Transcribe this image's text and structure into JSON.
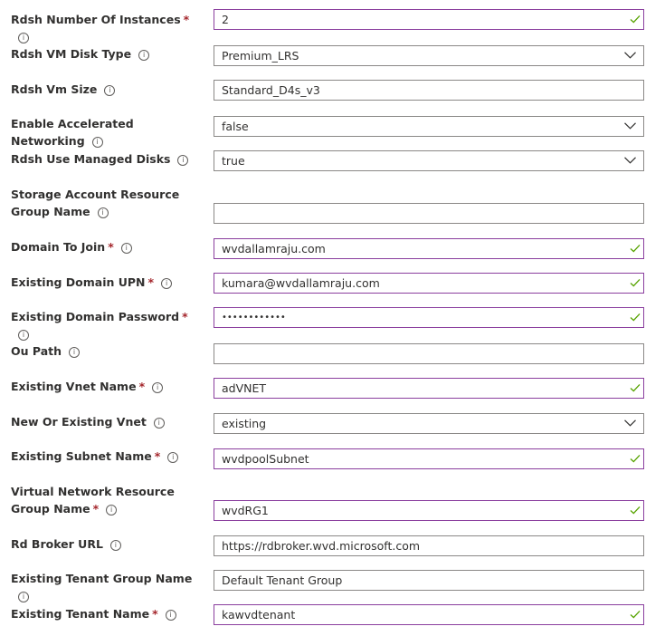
{
  "fields": [
    {
      "label": "Rdsh Number Of Instances",
      "required": "*",
      "value": "2",
      "kind": "text",
      "valid": true
    },
    {
      "label": "Rdsh VM Disk Type",
      "required": "",
      "value": "Premium_LRS",
      "kind": "select",
      "valid": false
    },
    {
      "label": "Rdsh Vm Size",
      "required": "",
      "value": "Standard_D4s_v3",
      "kind": "text",
      "valid": false
    },
    {
      "label": "Enable Accelerated Networking",
      "required": "",
      "value": "false",
      "kind": "select",
      "valid": false
    },
    {
      "label": "Rdsh Use Managed Disks",
      "required": "",
      "value": "true",
      "kind": "select",
      "valid": false
    },
    {
      "label": "Storage Account Resource Group Name",
      "required": "",
      "value": "",
      "kind": "text",
      "valid": false
    },
    {
      "label": "Domain To Join",
      "required": "*",
      "value": "wvdallamraju.com",
      "kind": "text",
      "valid": true
    },
    {
      "label": "Existing Domain UPN",
      "required": "*",
      "value": "kumara@wvdallamraju.com",
      "kind": "text",
      "valid": true
    },
    {
      "label": "Existing Domain Password",
      "required": "*",
      "value": "••••••••••••",
      "kind": "password",
      "valid": true
    },
    {
      "label": "Ou Path",
      "required": "",
      "value": "",
      "kind": "text",
      "valid": false
    },
    {
      "label": "Existing Vnet Name",
      "required": "*",
      "value": "adVNET",
      "kind": "text",
      "valid": true
    },
    {
      "label": "New Or Existing Vnet",
      "required": "",
      "value": "existing",
      "kind": "select",
      "valid": false
    },
    {
      "label": "Existing Subnet Name",
      "required": "*",
      "value": "wvdpoolSubnet",
      "kind": "text",
      "valid": true
    },
    {
      "label": "Virtual Network Resource Group Name",
      "required": "*",
      "value": "wvdRG1",
      "kind": "text",
      "valid": true
    },
    {
      "label": "Rd Broker URL",
      "required": "",
      "value": "https://rdbroker.wvd.microsoft.com",
      "kind": "text",
      "valid": false
    },
    {
      "label": "Existing Tenant Group Name",
      "required": "",
      "value": "Default Tenant Group",
      "kind": "text",
      "valid": false
    },
    {
      "label": "Existing Tenant Name",
      "required": "*",
      "value": "kawvdtenant",
      "kind": "text",
      "valid": true
    }
  ],
  "icons": {
    "info": "info-icon",
    "valid": "checkmark-icon",
    "dropdown": "chevron-down-icon"
  },
  "colors": {
    "required": "#a4262c",
    "valid_border": "#8a3e9e",
    "valid_check": "#57a300",
    "border": "#8a8886"
  }
}
